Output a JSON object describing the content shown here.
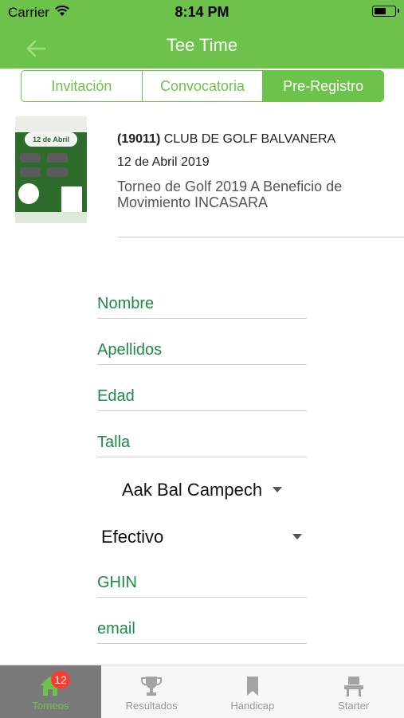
{
  "status": {
    "carrier": "Carrier",
    "time": "8:14 PM"
  },
  "nav": {
    "title": "Tee Time"
  },
  "segments": {
    "items": [
      "Invitación",
      "Convocatoria",
      "Pre-Registro"
    ],
    "active": "Pre-Registro"
  },
  "event": {
    "code": "(19011)",
    "club": "CLUB DE GOLF BALVANERA",
    "date": "12 de Abril 2019",
    "description": "Torneo de Golf 2019 A Beneficio de Movimiento INCASARA",
    "poster": {
      "banner_text": "12 de Abril"
    }
  },
  "form": {
    "nombre_placeholder": "Nombre",
    "apellidos_placeholder": "Apellidos",
    "edad_placeholder": "Edad",
    "talla_placeholder": "Talla",
    "club_value": "Aak Bal Campeche",
    "payment_value": "Efectivo",
    "ghin_placeholder": "GHIN",
    "email_placeholder": "email"
  },
  "tabs": [
    {
      "label": "Torneos",
      "icon": "home-icon",
      "badge": "12",
      "active": true
    },
    {
      "label": "Resultados",
      "icon": "trophy-icon"
    },
    {
      "label": "Handicap",
      "icon": "bookmark-icon"
    },
    {
      "label": "Starter",
      "icon": "chair-icon"
    }
  ],
  "colors": {
    "primary": "#6cc24a",
    "field_text": "#1e8a46",
    "badge": "#ff3b30",
    "active_tab_bg": "#7a7a7a"
  }
}
